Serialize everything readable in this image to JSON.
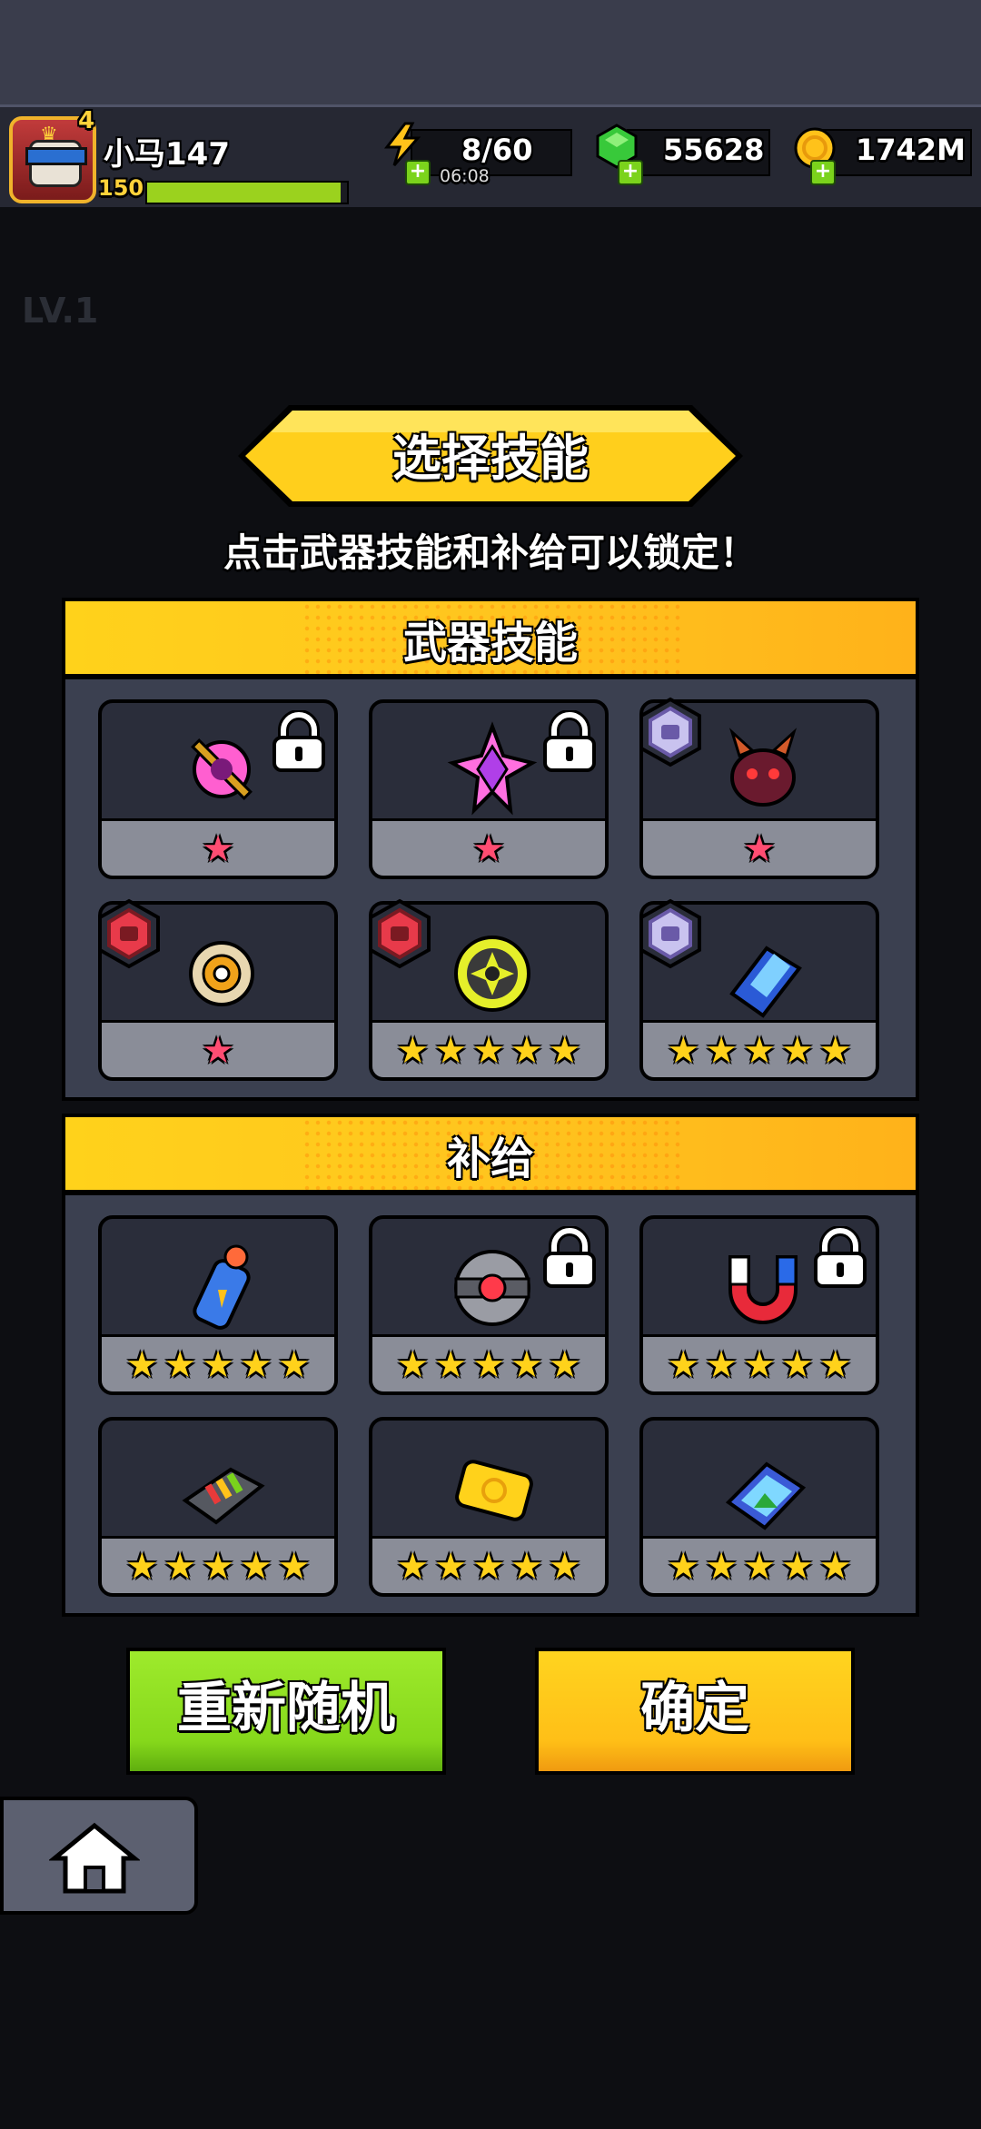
{
  "player": {
    "name": "小马147",
    "vip_level": "4",
    "level": "150",
    "xp_fraction": 0.97
  },
  "resources": {
    "energy": {
      "value": "8/60",
      "timer": "06:08",
      "icon": "lightning-icon"
    },
    "gems": {
      "value": "55628",
      "icon": "green-gem-icon"
    },
    "coins": {
      "value": "1742M",
      "icon": "gold-coin-icon"
    }
  },
  "title": "选择技能",
  "subtitle": "点击武器技能和补给可以锁定！",
  "weapon_section": {
    "title": "武器技能",
    "cards": [
      {
        "icon": "magic-staff-icon",
        "stars": 1,
        "star_color": "pink",
        "locked": true,
        "badge": null
      },
      {
        "icon": "purple-crystal-icon",
        "stars": 1,
        "star_color": "pink",
        "locked": true,
        "badge": null
      },
      {
        "icon": "demon-mask-icon",
        "stars": 1,
        "star_color": "pink",
        "locked": false,
        "badge": "camera-badge"
      },
      {
        "icon": "spinning-disc-icon",
        "stars": 1,
        "star_color": "pink",
        "locked": false,
        "badge": "red-device-badge"
      },
      {
        "icon": "yellow-shuriken-icon",
        "stars": 5,
        "star_color": "gold",
        "locked": false,
        "badge": "red-tower-badge"
      },
      {
        "icon": "blue-book-icon",
        "stars": 5,
        "star_color": "gold",
        "locked": false,
        "badge": "camera-badge"
      }
    ]
  },
  "supply_section": {
    "title": "补给",
    "cards": [
      {
        "icon": "fuel-bottle-icon",
        "stars": 5,
        "star_color": "gold",
        "locked": false
      },
      {
        "icon": "red-core-device-icon",
        "stars": 5,
        "star_color": "gold",
        "locked": true
      },
      {
        "icon": "magnet-icon",
        "stars": 5,
        "star_color": "gold",
        "locked": true
      },
      {
        "icon": "battery-pack-icon",
        "stars": 5,
        "star_color": "gold",
        "locked": false
      },
      {
        "icon": "gold-ticket-icon",
        "stars": 5,
        "star_color": "gold",
        "locked": false
      },
      {
        "icon": "photo-album-icon",
        "stars": 5,
        "star_color": "gold",
        "locked": false
      }
    ]
  },
  "buttons": {
    "reroll": "重新随机",
    "confirm": "确定"
  },
  "colors": {
    "banner_yellow": "#ffd21b",
    "reroll_green": "#86d81b",
    "confirm_yellow": "#ffbf17",
    "panel": "#3b4050"
  }
}
